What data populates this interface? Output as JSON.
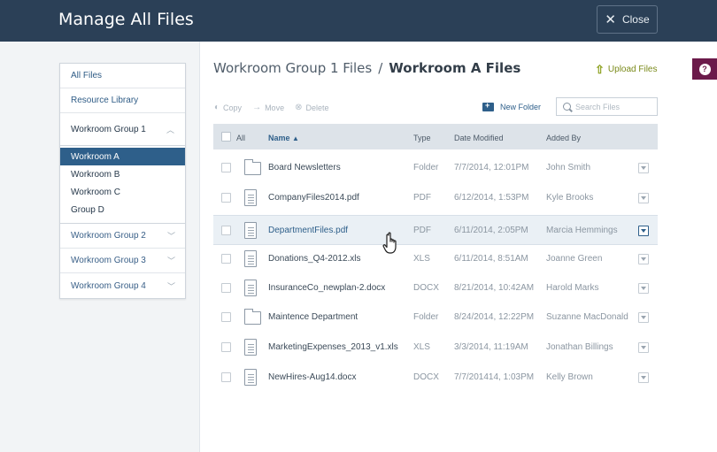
{
  "header": {
    "title": "Manage All Files",
    "close_label": "Close"
  },
  "help": {
    "label": "?"
  },
  "sidebar": {
    "all_files": "All Files",
    "resource_library": "Resource Library",
    "open_group": "Workroom Group 1",
    "sub_items": [
      "Workroom A",
      "Workroom B",
      "Workroom C",
      "Group D"
    ],
    "groups": [
      "Workroom Group 2",
      "Workroom Group 3",
      "Workroom Group 4"
    ]
  },
  "breadcrumb": {
    "parent": "Workroom Group 1 Files",
    "separator": "/",
    "current": "Workroom A Files"
  },
  "upload_label": "Upload Files",
  "toolbar": {
    "copy": "Copy",
    "move": "Move",
    "delete": "Delete",
    "new_folder": "New Folder",
    "search_placeholder": "Search Files"
  },
  "table": {
    "headers": {
      "all": "All",
      "name": "Name",
      "type": "Type",
      "date": "Date Modified",
      "added_by": "Added By"
    },
    "rows": [
      {
        "icon": "folder",
        "name": "Board Newsletters",
        "type": "Folder",
        "date": "7/7/2014, 12:01PM",
        "added_by": "John Smith"
      },
      {
        "icon": "doc",
        "name": "CompanyFiles2014.pdf",
        "type": "PDF",
        "date": "6/12/2014, 1:53PM",
        "added_by": "Kyle Brooks"
      },
      {
        "icon": "doc",
        "name": "DepartmentFiles.pdf",
        "type": "PDF",
        "date": "6/11/2014, 2:05PM",
        "added_by": "Marcia Hemmings"
      },
      {
        "icon": "doc",
        "name": "Donations_Q4-2012.xls",
        "type": "XLS",
        "date": "6/11/2014, 8:51AM",
        "added_by": "Joanne Green"
      },
      {
        "icon": "doc",
        "name": "InsuranceCo_newplan-2.docx",
        "type": "DOCX",
        "date": "8/21/2014, 10:42AM",
        "added_by": "Harold Marks"
      },
      {
        "icon": "folder",
        "name": "Maintence Department",
        "type": "Folder",
        "date": "8/24/2014, 12:22PM",
        "added_by": "Suzanne MacDonald"
      },
      {
        "icon": "doc",
        "name": "MarketingExpenses_2013_v1.xls",
        "type": "XLS",
        "date": "3/3/2014, 11:19AM",
        "added_by": "Jonathan Billings"
      },
      {
        "icon": "doc",
        "name": "NewHires-Aug14.docx",
        "type": "DOCX",
        "date": "7/7/201414, 1:03PM",
        "added_by": "Kelly Brown"
      }
    ]
  },
  "colors": {
    "header_bg": "#2b4057",
    "accent": "#2e5f8a",
    "upload": "#8ca01e",
    "help_tab": "#6b1a4a"
  }
}
